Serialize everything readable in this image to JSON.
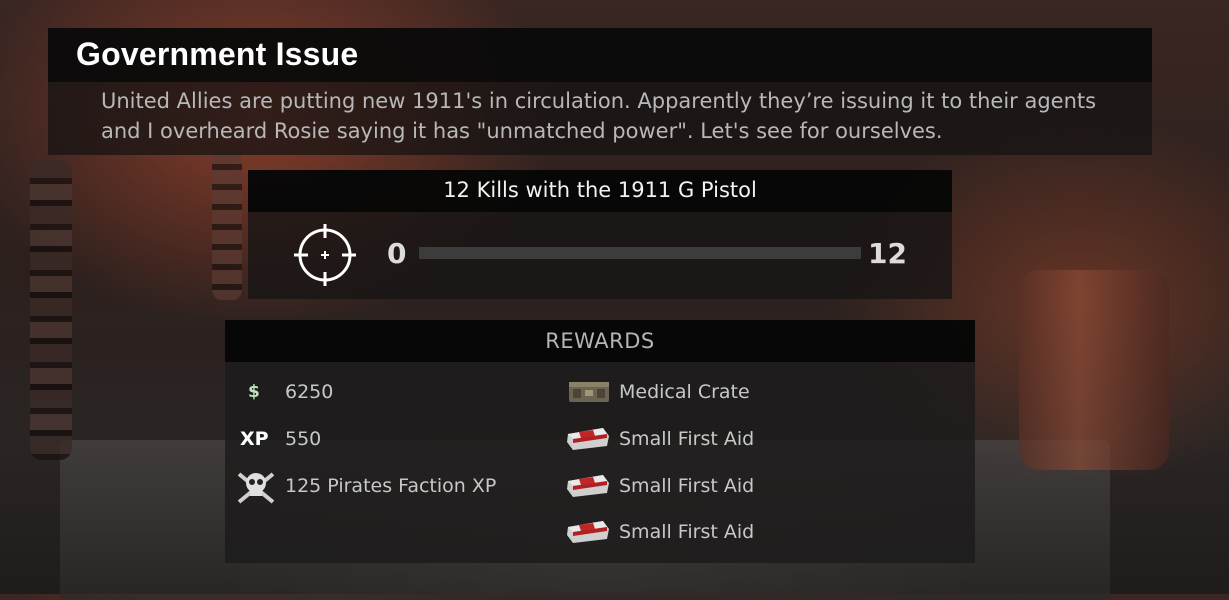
{
  "challenge": {
    "title": "Government Issue",
    "description": "United Allies are putting new 1911's in circulation. Apparently they’re issuing it to their agents and I overheard Rosie saying it has \"unmatched power\". Let's see for ourselves.",
    "objective": "12 Kills with the 1911 G Pistol",
    "progress": {
      "current_label": "0",
      "target_label": "12",
      "fraction": 0.0
    }
  },
  "rewards": {
    "header": "REWARDS",
    "left": [
      {
        "icon": "money-icon",
        "icon_text": "$",
        "label": "6250"
      },
      {
        "icon": "xp-icon",
        "icon_text": "XP",
        "label": "550"
      },
      {
        "icon": "pirates-skull-icon",
        "label": "125 Pirates Faction XP"
      }
    ],
    "right": [
      {
        "icon": "medical-crate-icon",
        "label": "Medical Crate"
      },
      {
        "icon": "first-aid-kit-icon",
        "label": "Small First Aid"
      },
      {
        "icon": "first-aid-kit-icon",
        "label": "Small First Aid"
      },
      {
        "icon": "first-aid-kit-icon",
        "label": "Small First Aid"
      }
    ]
  },
  "colors": {
    "money": "#b9e6b9",
    "panel": "#1c1b1b",
    "text": "#c8c8c8"
  }
}
